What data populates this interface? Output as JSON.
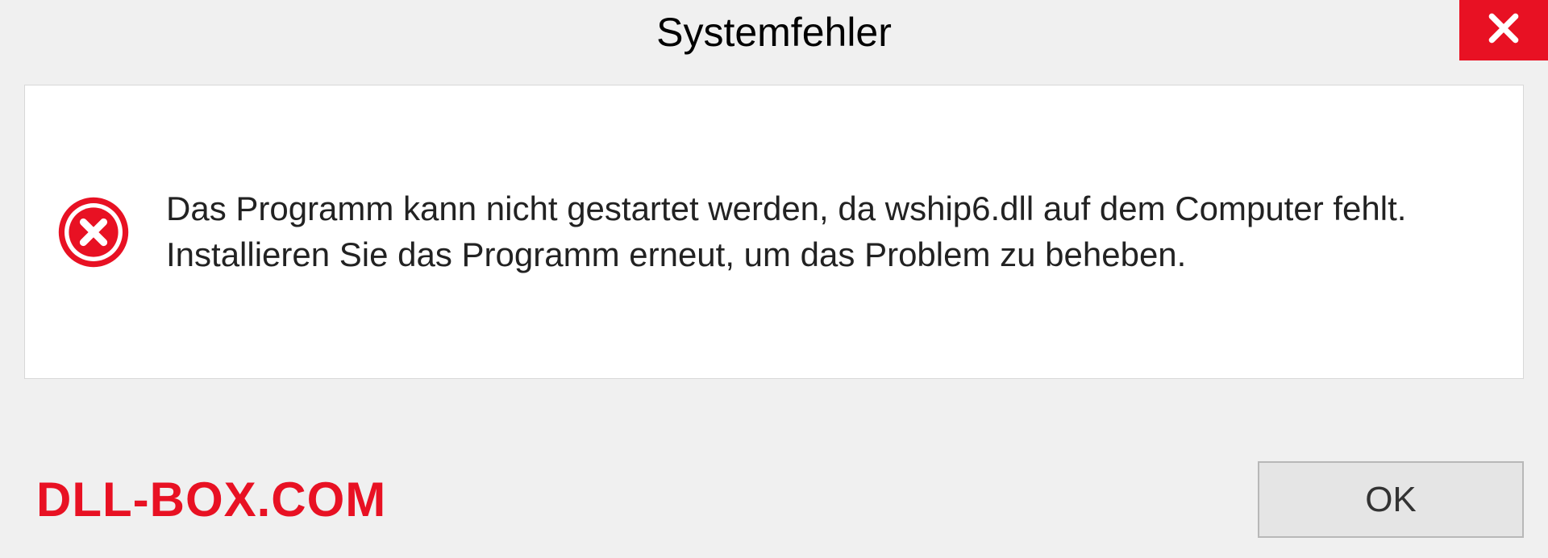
{
  "dialog": {
    "title": "Systemfehler",
    "message": "Das Programm kann nicht gestartet werden, da wship6.dll auf dem Computer fehlt. Installieren Sie das Programm erneut, um das Problem zu beheben.",
    "ok_label": "OK"
  },
  "watermark": "DLL-BOX.COM"
}
